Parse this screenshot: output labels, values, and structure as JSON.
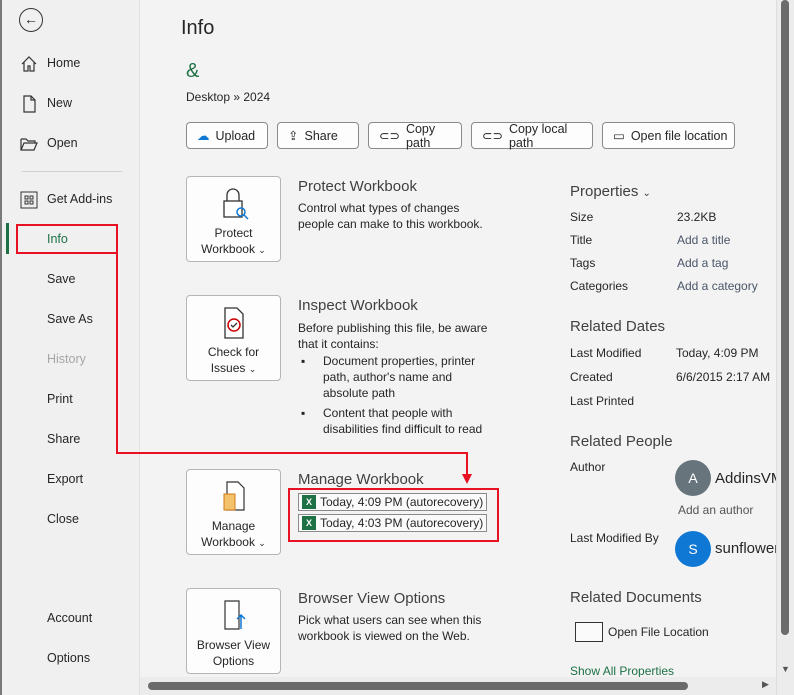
{
  "sidebar": {
    "back": "back",
    "items": [
      {
        "label": "Home",
        "icon": "home-icon"
      },
      {
        "label": "New",
        "icon": "new-document-icon"
      },
      {
        "label": "Open",
        "icon": "open-folder-icon"
      },
      {
        "label": "Get Add-ins",
        "icon": "addins-grid-icon"
      },
      {
        "label": "Info",
        "active": true
      },
      {
        "label": "Save"
      },
      {
        "label": "Save As"
      },
      {
        "label": "History",
        "disabled": true
      },
      {
        "label": "Print"
      },
      {
        "label": "Share"
      },
      {
        "label": "Export"
      },
      {
        "label": "Close"
      },
      {
        "label": "Account"
      },
      {
        "label": "Options"
      }
    ]
  },
  "header": {
    "title": "Info",
    "file_name": "&",
    "path": "Desktop » 2024"
  },
  "toolbar": {
    "upload": "Upload",
    "share": "Share",
    "copy_path": "Copy path",
    "copy_local_path": "Copy local path",
    "open_file_location": "Open file location"
  },
  "sections": {
    "protect": {
      "button": "Protect Workbook",
      "title": "Protect Workbook",
      "text": "Control what types of changes people can make to this workbook."
    },
    "inspect": {
      "button": "Check for Issues",
      "title": "Inspect Workbook",
      "text": "Before publishing this file, be aware that it contains:",
      "bullets": [
        "Document properties, printer path, author's name and absolute path",
        "Content that people with disabilities find difficult to read"
      ]
    },
    "manage": {
      "button": "Manage Workbook",
      "title": "Manage Workbook",
      "versions": [
        "Today, 4:09 PM (autorecovery)",
        "Today, 4:03 PM (autorecovery)"
      ]
    },
    "browser": {
      "button": "Browser View Options",
      "title": "Browser View Options",
      "text": "Pick what users can see when this workbook is viewed on the Web."
    }
  },
  "properties": {
    "title": "Properties",
    "rows": [
      {
        "label": "Size",
        "value": "23.2KB"
      },
      {
        "label": "Title",
        "value": "Add a title"
      },
      {
        "label": "Tags",
        "value": "Add a tag"
      },
      {
        "label": "Categories",
        "value": "Add a category"
      }
    ]
  },
  "related_dates": {
    "title": "Related Dates",
    "rows": [
      {
        "label": "Last Modified",
        "value": "Today, 4:09 PM"
      },
      {
        "label": "Created",
        "value": "6/6/2015 2:17 AM"
      },
      {
        "label": "Last Printed",
        "value": ""
      }
    ]
  },
  "related_people": {
    "title": "Related People",
    "author_label": "Author",
    "author_initial": "A",
    "author_name": "AddinsVM",
    "add_author": "Add an author",
    "modified_label": "Last Modified By",
    "modified_initial": "S",
    "modified_name": "sunflower"
  },
  "related_documents": {
    "title": "Related Documents",
    "open_location": "Open File Location",
    "show_all": "Show All Properties"
  },
  "colors": {
    "accent": "#1e7145",
    "annotation": "#e81123",
    "author_avatar": "#67747c",
    "modifier_avatar": "#0f78d4"
  }
}
